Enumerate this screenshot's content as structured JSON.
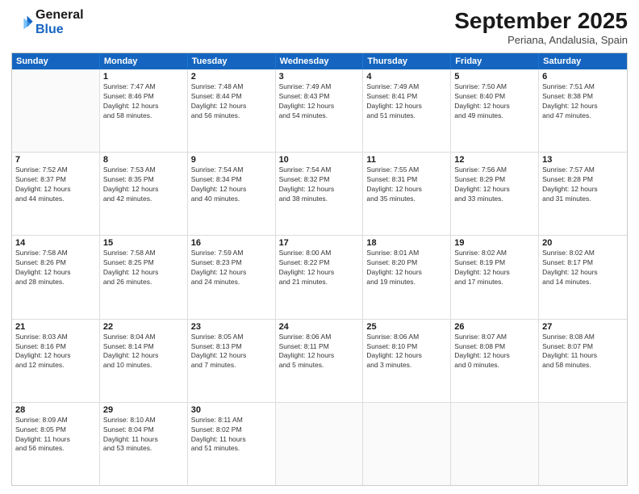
{
  "header": {
    "logo_line1": "General",
    "logo_line2": "Blue",
    "month": "September 2025",
    "location": "Periana, Andalusia, Spain"
  },
  "weekdays": [
    "Sunday",
    "Monday",
    "Tuesday",
    "Wednesday",
    "Thursday",
    "Friday",
    "Saturday"
  ],
  "rows": [
    [
      {
        "day": "",
        "info": ""
      },
      {
        "day": "1",
        "info": "Sunrise: 7:47 AM\nSunset: 8:46 PM\nDaylight: 12 hours\nand 58 minutes."
      },
      {
        "day": "2",
        "info": "Sunrise: 7:48 AM\nSunset: 8:44 PM\nDaylight: 12 hours\nand 56 minutes."
      },
      {
        "day": "3",
        "info": "Sunrise: 7:49 AM\nSunset: 8:43 PM\nDaylight: 12 hours\nand 54 minutes."
      },
      {
        "day": "4",
        "info": "Sunrise: 7:49 AM\nSunset: 8:41 PM\nDaylight: 12 hours\nand 51 minutes."
      },
      {
        "day": "5",
        "info": "Sunrise: 7:50 AM\nSunset: 8:40 PM\nDaylight: 12 hours\nand 49 minutes."
      },
      {
        "day": "6",
        "info": "Sunrise: 7:51 AM\nSunset: 8:38 PM\nDaylight: 12 hours\nand 47 minutes."
      }
    ],
    [
      {
        "day": "7",
        "info": "Sunrise: 7:52 AM\nSunset: 8:37 PM\nDaylight: 12 hours\nand 44 minutes."
      },
      {
        "day": "8",
        "info": "Sunrise: 7:53 AM\nSunset: 8:35 PM\nDaylight: 12 hours\nand 42 minutes."
      },
      {
        "day": "9",
        "info": "Sunrise: 7:54 AM\nSunset: 8:34 PM\nDaylight: 12 hours\nand 40 minutes."
      },
      {
        "day": "10",
        "info": "Sunrise: 7:54 AM\nSunset: 8:32 PM\nDaylight: 12 hours\nand 38 minutes."
      },
      {
        "day": "11",
        "info": "Sunrise: 7:55 AM\nSunset: 8:31 PM\nDaylight: 12 hours\nand 35 minutes."
      },
      {
        "day": "12",
        "info": "Sunrise: 7:56 AM\nSunset: 8:29 PM\nDaylight: 12 hours\nand 33 minutes."
      },
      {
        "day": "13",
        "info": "Sunrise: 7:57 AM\nSunset: 8:28 PM\nDaylight: 12 hours\nand 31 minutes."
      }
    ],
    [
      {
        "day": "14",
        "info": "Sunrise: 7:58 AM\nSunset: 8:26 PM\nDaylight: 12 hours\nand 28 minutes."
      },
      {
        "day": "15",
        "info": "Sunrise: 7:58 AM\nSunset: 8:25 PM\nDaylight: 12 hours\nand 26 minutes."
      },
      {
        "day": "16",
        "info": "Sunrise: 7:59 AM\nSunset: 8:23 PM\nDaylight: 12 hours\nand 24 minutes."
      },
      {
        "day": "17",
        "info": "Sunrise: 8:00 AM\nSunset: 8:22 PM\nDaylight: 12 hours\nand 21 minutes."
      },
      {
        "day": "18",
        "info": "Sunrise: 8:01 AM\nSunset: 8:20 PM\nDaylight: 12 hours\nand 19 minutes."
      },
      {
        "day": "19",
        "info": "Sunrise: 8:02 AM\nSunset: 8:19 PM\nDaylight: 12 hours\nand 17 minutes."
      },
      {
        "day": "20",
        "info": "Sunrise: 8:02 AM\nSunset: 8:17 PM\nDaylight: 12 hours\nand 14 minutes."
      }
    ],
    [
      {
        "day": "21",
        "info": "Sunrise: 8:03 AM\nSunset: 8:16 PM\nDaylight: 12 hours\nand 12 minutes."
      },
      {
        "day": "22",
        "info": "Sunrise: 8:04 AM\nSunset: 8:14 PM\nDaylight: 12 hours\nand 10 minutes."
      },
      {
        "day": "23",
        "info": "Sunrise: 8:05 AM\nSunset: 8:13 PM\nDaylight: 12 hours\nand 7 minutes."
      },
      {
        "day": "24",
        "info": "Sunrise: 8:06 AM\nSunset: 8:11 PM\nDaylight: 12 hours\nand 5 minutes."
      },
      {
        "day": "25",
        "info": "Sunrise: 8:06 AM\nSunset: 8:10 PM\nDaylight: 12 hours\nand 3 minutes."
      },
      {
        "day": "26",
        "info": "Sunrise: 8:07 AM\nSunset: 8:08 PM\nDaylight: 12 hours\nand 0 minutes."
      },
      {
        "day": "27",
        "info": "Sunrise: 8:08 AM\nSunset: 8:07 PM\nDaylight: 11 hours\nand 58 minutes."
      }
    ],
    [
      {
        "day": "28",
        "info": "Sunrise: 8:09 AM\nSunset: 8:05 PM\nDaylight: 11 hours\nand 56 minutes."
      },
      {
        "day": "29",
        "info": "Sunrise: 8:10 AM\nSunset: 8:04 PM\nDaylight: 11 hours\nand 53 minutes."
      },
      {
        "day": "30",
        "info": "Sunrise: 8:11 AM\nSunset: 8:02 PM\nDaylight: 11 hours\nand 51 minutes."
      },
      {
        "day": "",
        "info": ""
      },
      {
        "day": "",
        "info": ""
      },
      {
        "day": "",
        "info": ""
      },
      {
        "day": "",
        "info": ""
      }
    ]
  ]
}
